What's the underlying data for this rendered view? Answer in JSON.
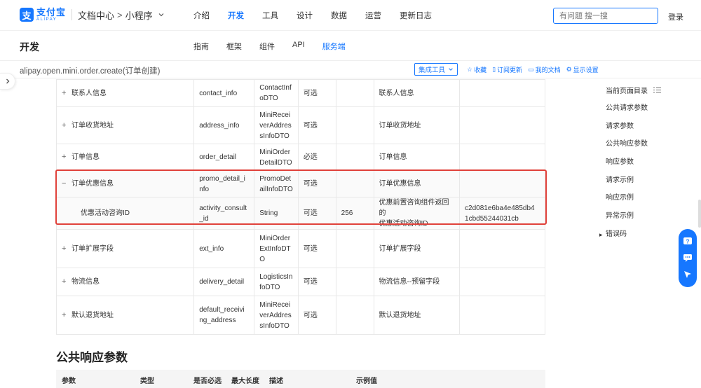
{
  "header": {
    "logo_mark": "支",
    "logo_cn": "支付宝",
    "logo_en": "ALIPAY",
    "breadcrumb_doc": "文档中心",
    "breadcrumb_sep": ">",
    "breadcrumb_product": "小程序",
    "nav": [
      "介绍",
      "开发",
      "工具",
      "设计",
      "数据",
      "运营",
      "更新日志"
    ],
    "nav_active": "开发",
    "search_placeholder": "有问题 搜一搜",
    "login": "登录"
  },
  "subheader": {
    "title": "开发",
    "tabs": [
      "指南",
      "框架",
      "组件",
      "API",
      "服务端"
    ],
    "active_tab": "服务端"
  },
  "pathbar": {
    "path": "alipay.open.mini.order.create(订单创建)",
    "tools_select": "集成工具",
    "links": [
      "收藏",
      "订阅更新",
      "我的文档",
      "显示设置"
    ]
  },
  "params_table": {
    "rows": [
      {
        "expander": "+",
        "name": "联系人信息",
        "field": [
          "contact_info"
        ],
        "type": [
          "ContactInf",
          "oDTO"
        ],
        "required": "可选",
        "maxlen": "",
        "desc": [
          "联系人信息"
        ],
        "example": []
      },
      {
        "expander": "+",
        "name": "订单收货地址",
        "field": [
          "address_info"
        ],
        "type": [
          "MiniRecei",
          "verAddres",
          "sInfoDTO"
        ],
        "required": "可选",
        "maxlen": "",
        "desc": [
          "订单收货地址"
        ],
        "example": []
      },
      {
        "expander": "+",
        "name": "订单信息",
        "field": [
          "order_detail"
        ],
        "type": [
          "MiniOrder",
          "DetailDTO"
        ],
        "required": "必选",
        "maxlen": "",
        "desc": [
          "订单信息"
        ],
        "example": []
      },
      {
        "expander": "−",
        "name": "订单优惠信息",
        "field": [
          "promo_detail_i",
          "nfo"
        ],
        "type": [
          "PromoDet",
          "ailInfoDTO"
        ],
        "required": "可选",
        "maxlen": "",
        "desc": [
          "订单优惠信息"
        ],
        "example": [],
        "highlight": true
      },
      {
        "expander": "",
        "name": "优惠活动咨询ID",
        "field": [
          "activity_consult",
          "_id"
        ],
        "type": [
          "String"
        ],
        "required": "可选",
        "maxlen": "256",
        "desc": [
          "优惠前置咨询组件返回的",
          "优惠活动咨询ID"
        ],
        "example": [
          "c2d081e6ba4e485db4",
          "1cbd55244031cb"
        ],
        "child": true,
        "highlight": true
      },
      {
        "expander": "+",
        "name": "订单扩展字段",
        "field": [
          "ext_info"
        ],
        "type": [
          "MiniOrder",
          "ExtInfoDT",
          "O"
        ],
        "required": "可选",
        "maxlen": "",
        "desc": [
          "订单扩展字段"
        ],
        "example": []
      },
      {
        "expander": "+",
        "name": "物流信息",
        "field": [
          "delivery_detail"
        ],
        "type": [
          "LogisticsIn",
          "foDTO"
        ],
        "required": "可选",
        "maxlen": "",
        "desc": [
          "物流信息--预留字段"
        ],
        "example": []
      },
      {
        "expander": "+",
        "name": "默认退货地址",
        "field": [
          "default_receivi",
          "ng_address"
        ],
        "type": [
          "MiniRecei",
          "verAddres",
          "sInfoDTO"
        ],
        "required": "可选",
        "maxlen": "",
        "desc": [
          "默认退货地址"
        ],
        "example": []
      }
    ]
  },
  "response_section": {
    "title": "公共响应参数",
    "headers": [
      "参数",
      "类型",
      "是否必选",
      "最大长度",
      "描述",
      "示例值"
    ]
  },
  "toc": {
    "title": "当前页面目录",
    "items": [
      "公共请求参数",
      "请求参数",
      "公共响应参数",
      "响应参数",
      "请求示例",
      "响应示例",
      "异常示例",
      "错误码"
    ]
  },
  "colors": {
    "accent": "#1677ff",
    "highlight_border": "#e0413a"
  }
}
